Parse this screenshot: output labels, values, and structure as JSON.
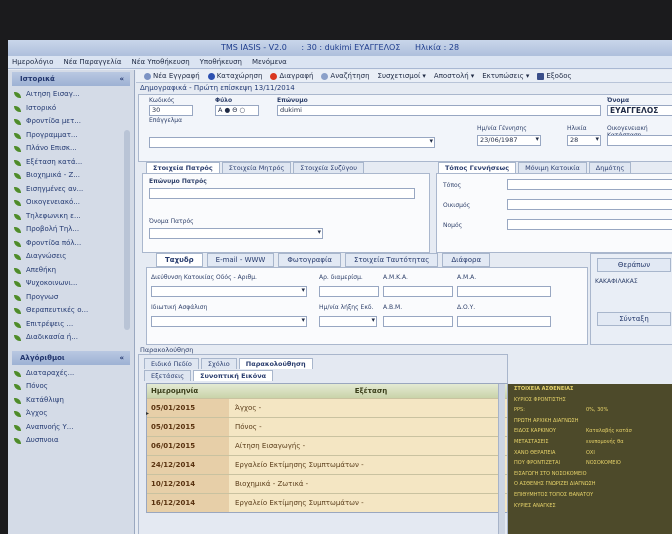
{
  "window": {
    "title_app": "TMS IASIS - V2.0",
    "title_record": ": 30 : dukimi ΕΥΑΓΓΕΛΟΣ",
    "title_age": "Ηλικία : 28"
  },
  "menubar": [
    "Ημερολόγιο",
    "Νέα Παραγγελία",
    "Νέα Υποθήκευση",
    "Υποθήκευση",
    "Μενόμενα"
  ],
  "sidebar": {
    "section1": "Ιστορικά",
    "items1": [
      "Αιτηση Εισαγ...",
      "Ιστορικό",
      "Φροντίδα μετ...",
      "Προγραμματ...",
      "Πλάνο Επισκ...",
      "Εξέταση κατά...",
      "Βιοχημικά - Ζ...",
      "Εισηγμένες αν...",
      "Οικογενειακό...",
      "Τηλεφωνικη ε...",
      "Προβολή Τηλ...",
      "Φροντίδα πόλ...",
      "Διαγνώσεις",
      "Απεθήκη",
      "Ψυχοκοινωνι...",
      "Προγνωσ",
      "Θεραπευτικές ο...",
      "Επιτρέψεις ...",
      "Διαδικασία ή..."
    ],
    "section2": "Αλγόριθμοι",
    "items2": [
      "Διαταραχές...",
      "Πόνος",
      "Κατάθλιψη",
      "Άγχος",
      "Αναπνοής Υ...",
      "Δυσπνοια"
    ]
  },
  "toolbar": [
    "Νέα Εγγραφή",
    "Καταχώρηση",
    "Διαγραφή",
    "Αναζήτηση",
    "Συσχετισμοί",
    "Αποστολή",
    "Εκτυπώσεις",
    "Εξοδος"
  ],
  "doc_title": "Δημογραφικά  -  Πρώτη επίσκεψη  13/11/2014",
  "demo": {
    "code_label": "Κωδικός",
    "code_value": "30",
    "sex_label": "Φύλο",
    "sex_value": "Α ● Θ ○",
    "surname_label": "Επώνυμο",
    "surname_value": "dukimi",
    "name_label": "Όνομα",
    "name_value": "ΕΥΑΓΓΕΛΟΣ",
    "prof_label": "Επάγγελμα",
    "dob_label": "Ημ/νία Γέννησης",
    "dob_value": "23/06/1987",
    "age_label": "Ηλικία",
    "age_value": "28",
    "family_label": "Οικογενειακή Κατάσταση"
  },
  "parent_tabs": [
    "Στοιχεία Πατρός",
    "Στοιχεία Μητρός",
    "Στοιχεία Συζύγου"
  ],
  "parent": {
    "surname": "Επώνυμο Πατρός",
    "name": "Όνομα Πατρός"
  },
  "place_tabs": [
    "Τόπος Γεννήσεως",
    "Μόνιμη Κατοικία",
    "Δημότης"
  ],
  "place": [
    "Τόπος",
    "Οικισμός",
    "Νομός"
  ],
  "contact_tabs": [
    "Ταχυδρ",
    "E-mail - WWW",
    "Φωτογραφία",
    "Στοιχεία Ταυτότητας",
    "Διάφορα"
  ],
  "contact": {
    "addr": "Διεύθυνση Κατοικίας Οδός - Αριθμ.",
    "num": "Αρ. διαμερίσμ.",
    "amka": "Α.Μ.Κ.Α.",
    "ama": "Α.Μ.Α.",
    "insurance": "Ιδιωτική Ασφάλιση",
    "ins_date": "Ημ/νία λήξης Εκδ.",
    "abm": "Α.Β.Μ.",
    "doy": "Δ.Ο.Υ."
  },
  "side_right": {
    "title": "Θεράπων",
    "value": "ΚΑΚΑΦΙΛΑΚΑΣ",
    "btn": "Σύνταξη"
  },
  "lower": {
    "header": "Παρακολούθηση",
    "tabs": [
      "Ειδικό Πεδίο",
      "Σχόλιο",
      "Παρακολούθηση"
    ],
    "subtabs": [
      "Εξετάσεις",
      "Συνοπτική Εικόνα"
    ],
    "col_date": "Ημερομηνία",
    "col_exam": "Εξέταση",
    "rows": [
      {
        "date": "05/01/2015",
        "exam": "Άγχος -"
      },
      {
        "date": "05/01/2015",
        "exam": "Πόνος -"
      },
      {
        "date": "06/01/2015",
        "exam": "Αίτηση Εισαγωγής -"
      },
      {
        "date": "24/12/2014",
        "exam": "Εργαλείο Εκτίμησης Συμπτωμάτων -"
      },
      {
        "date": "10/12/2014",
        "exam": "Βιοχημικά - Ζωτικά -"
      },
      {
        "date": "16/12/2014",
        "exam": "Εργαλείο Εκτίμησης Συμπτωμάτων -"
      }
    ]
  },
  "summary": [
    {
      "k": "ΣΤΟΙΧΕΙΑ ΑΣΘΕΝΕΙΑΣ",
      "v": ""
    },
    {
      "k": "ΚΥΡΙΟΣ ΦΡΟΝΤΙΣΤΗΣ",
      "v": ""
    },
    {
      "k": "PPS:",
      "v": "0%, 30%"
    },
    {
      "k": "ΠΡΩΤΗ ΑΡΧΙΚΗ ΔΙΑΓΝΩΣΗ",
      "v": ""
    },
    {
      "k": "ΕΙΔΟΣ ΚΑΡΚΙΝΟΥ",
      "v": "Καταλαβής κατάσ"
    },
    {
      "k": "ΜΕΤΑΣΤΑΣΕΙΣ",
      "v": "ενυπομονής θα"
    },
    {
      "k": "ΧΑΝΟ ΘΕΡΑΠΕΙΑ",
      "v": "ΟΧΙ"
    },
    {
      "k": "ΠΟΥ ΦΡΟΝΤΙΖΕΤΑΙ",
      "v": "ΝΟΣΟΚΟΜΕΙΟ"
    },
    {
      "k": "ΕΙΣΑΓΩΓΗ ΣΤΟ ΝΟΣΟΚΟΜΕΙΟ",
      "v": ""
    },
    {
      "k": "Ο ΑΣΘΕΝΗΣ ΓΝΩΡΙΖΕΙ ΔΙΑΓΝΩΣΗ",
      "v": ""
    },
    {
      "k": "ΕΠΙΘΥΜΗΤΟΣ ΤΟΠΟΣ ΘΑΝΑΤΟΥ",
      "v": ""
    },
    {
      "k": "ΚΥΡΙΕΣ ΑΝΑΓΚΕΣ",
      "v": ""
    }
  ]
}
